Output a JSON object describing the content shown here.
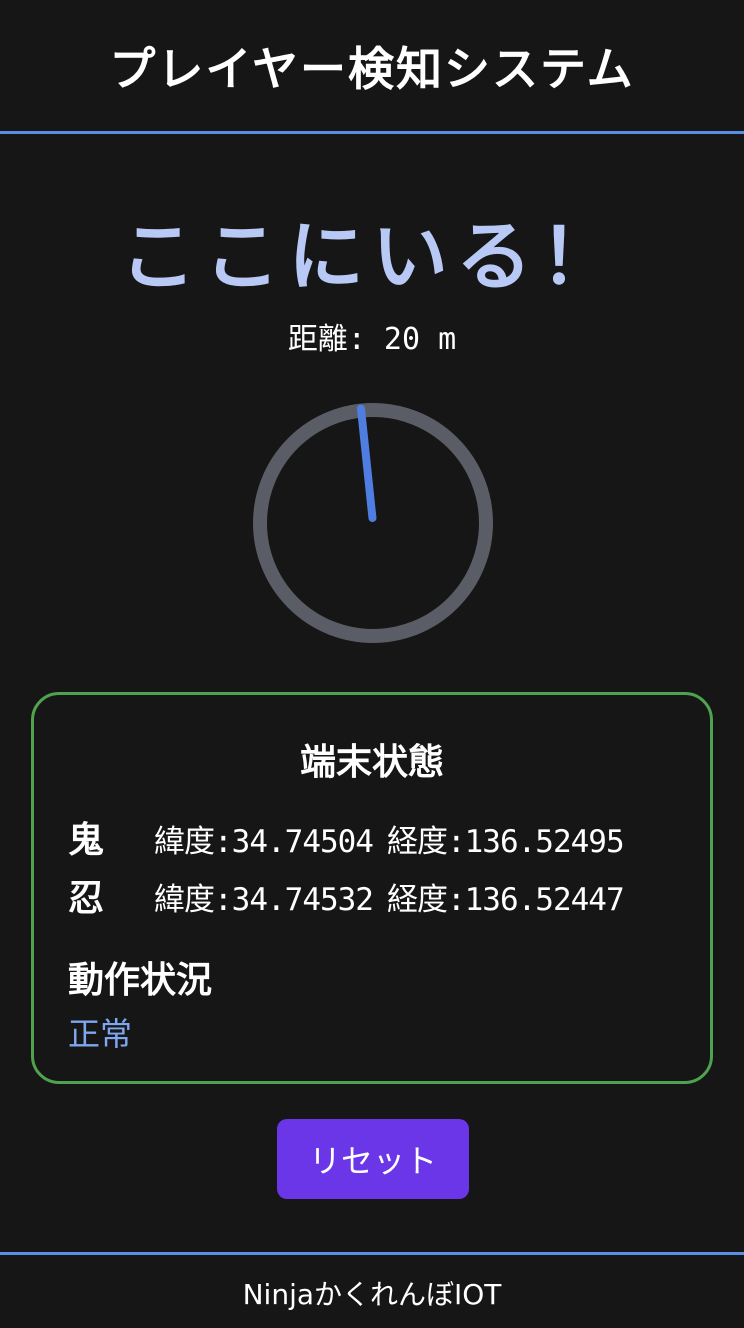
{
  "header": {
    "title": "プレイヤー検知システム"
  },
  "detection": {
    "headline": "ここにいる！",
    "distance_text": "距離: 20 m",
    "bearing_degrees": -6
  },
  "colors": {
    "accent_blue": "#5b8de3",
    "headline": "#b8c9f5",
    "panel_border": "#4fa34f",
    "button": "#6a36e8",
    "status_ok": "#7fa7f0",
    "compass_ring": "#5a5d66",
    "compass_needle": "#4f7ee0"
  },
  "device_status": {
    "title": "端末状態",
    "entries": [
      {
        "role": "鬼",
        "latitude_label": "緯度:34.74504",
        "longitude_label": "経度:136.52495"
      },
      {
        "role": "忍",
        "latitude_label": "緯度:34.74532",
        "longitude_label": "経度:136.52447"
      }
    ],
    "operation_label": "動作状況",
    "operation_value": "正常"
  },
  "actions": {
    "reset_label": "リセット"
  },
  "footer": {
    "text": "NinjaかくれんぼIOT"
  }
}
